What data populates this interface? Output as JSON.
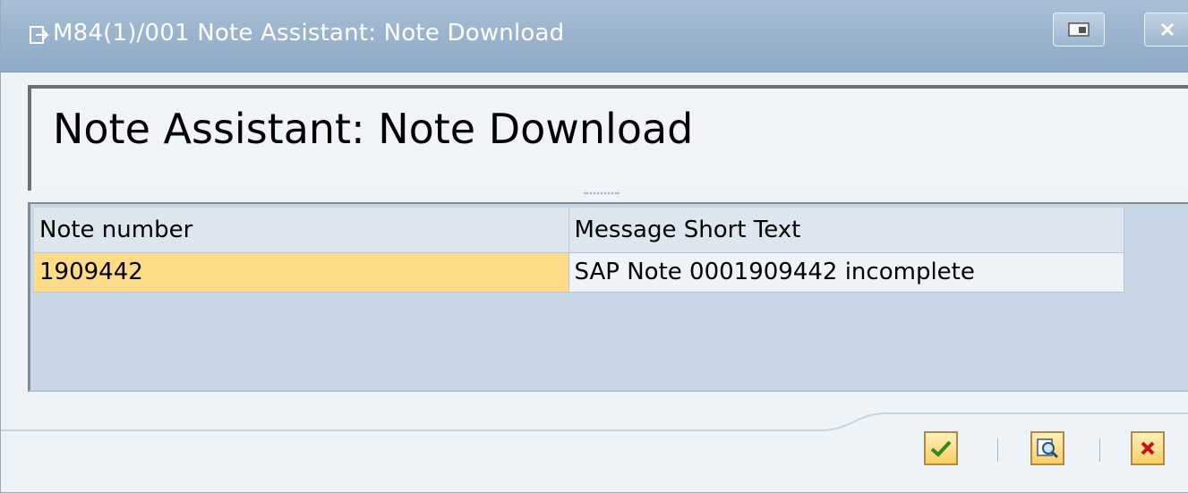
{
  "window": {
    "title": "M84(1)/001 Note Assistant: Note Download",
    "title_icon": "dialog-window-icon",
    "restore_icon": "restore-window-icon",
    "close_icon": "close-icon"
  },
  "header": {
    "title": "Note Assistant: Note Download"
  },
  "table": {
    "columns": [
      "Note number",
      "Message Short Text"
    ],
    "rows": [
      [
        "1909442",
        "SAP Note 0001909442 incomplete"
      ]
    ],
    "selected_cell_color": "#fddb87"
  },
  "footer": {
    "buttons": [
      {
        "name": "continue-button",
        "icon": "checkmark-icon"
      },
      {
        "name": "find-button",
        "icon": "find-icon"
      },
      {
        "name": "cancel-button",
        "icon": "cancel-x-icon"
      }
    ]
  },
  "colors": {
    "titlebar": "#9cb4ce",
    "background": "#eef3f7",
    "table_background": "#c8d7e6",
    "accent_button": "#f7cf63"
  }
}
